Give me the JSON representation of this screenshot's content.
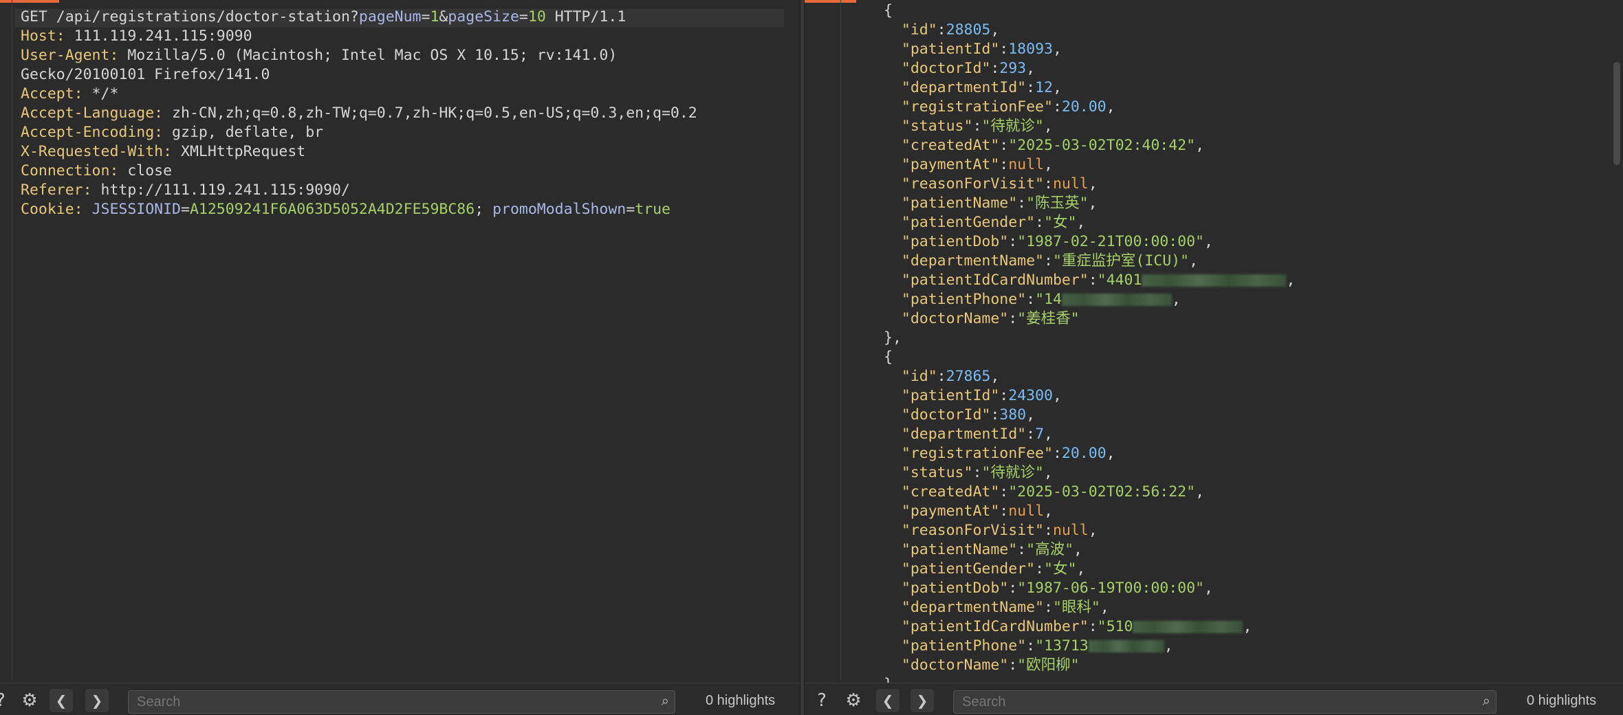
{
  "request": {
    "method": "GET",
    "path": "/api/registrations/doctor-station?",
    "query": [
      {
        "key": "pageNum",
        "value": "1"
      },
      {
        "key": "pageSize",
        "value": "10"
      }
    ],
    "protocol": "HTTP/1.1",
    "headers": [
      {
        "name": "Host",
        "value": "111.119.241.115:9090"
      },
      {
        "name": "User-Agent",
        "value": "Mozilla/5.0 (Macintosh; Intel Mac OS X 10.15; rv:141.0)"
      },
      {
        "name": "",
        "value": "Gecko/20100101 Firefox/141.0"
      },
      {
        "name": "Accept",
        "value": "*/*"
      },
      {
        "name": "Accept-Language",
        "value": "zh-CN,zh;q=0.8,zh-TW;q=0.7,zh-HK;q=0.5,en-US;q=0.3,en;q=0.2"
      },
      {
        "name": "Accept-Encoding",
        "value": "gzip, deflate, br"
      },
      {
        "name": "X-Requested-With",
        "value": "XMLHttpRequest"
      },
      {
        "name": "Connection",
        "value": "close"
      },
      {
        "name": "Referer",
        "value": "http://111.119.241.115:9090/"
      }
    ],
    "cookie_name": "Cookie",
    "cookies": [
      {
        "key": "JSESSIONID",
        "value": "A12509241F6A063D5052A4D2FE59BC86"
      },
      {
        "key": "promoModalShown",
        "value": "true"
      }
    ]
  },
  "response": {
    "records": [
      {
        "id": "28805",
        "patientId": "18093",
        "doctorId": "293",
        "departmentId": "12",
        "registrationFee": "20.00",
        "status": "待就诊",
        "createdAt": "2025-03-02T02:40:42",
        "paymentAt": "null",
        "reasonForVisit": "null",
        "patientName": "陈玉英",
        "patientGender": "女",
        "patientDob": "1987-02-21T00:00:00",
        "departmentName": "重症监护室(ICU)",
        "patientIdCardNumber_visible": "4401",
        "patientPhone_visible": "14",
        "doctorName": "姜桂香"
      },
      {
        "id": "27865",
        "patientId": "24300",
        "doctorId": "380",
        "departmentId": "7",
        "registrationFee": "20.00",
        "status": "待就诊",
        "createdAt": "2025-03-02T02:56:22",
        "paymentAt": "null",
        "reasonForVisit": "null",
        "patientName": "高波",
        "patientGender": "女",
        "patientDob": "1987-06-19T00:00:00",
        "departmentName": "眼科",
        "patientIdCardNumber_visible": "510",
        "patientPhone_visible": "13713",
        "doctorName": "欧阳柳"
      }
    ]
  },
  "toolbar": {
    "help_icon": "?",
    "settings_icon": "⚙",
    "prev_icon": "❮",
    "next_icon": "❯",
    "search_placeholder": "Search",
    "highlights_label": "0 highlights"
  },
  "colors": {
    "accent": "#e8683b",
    "background": "#2b2b2b"
  }
}
